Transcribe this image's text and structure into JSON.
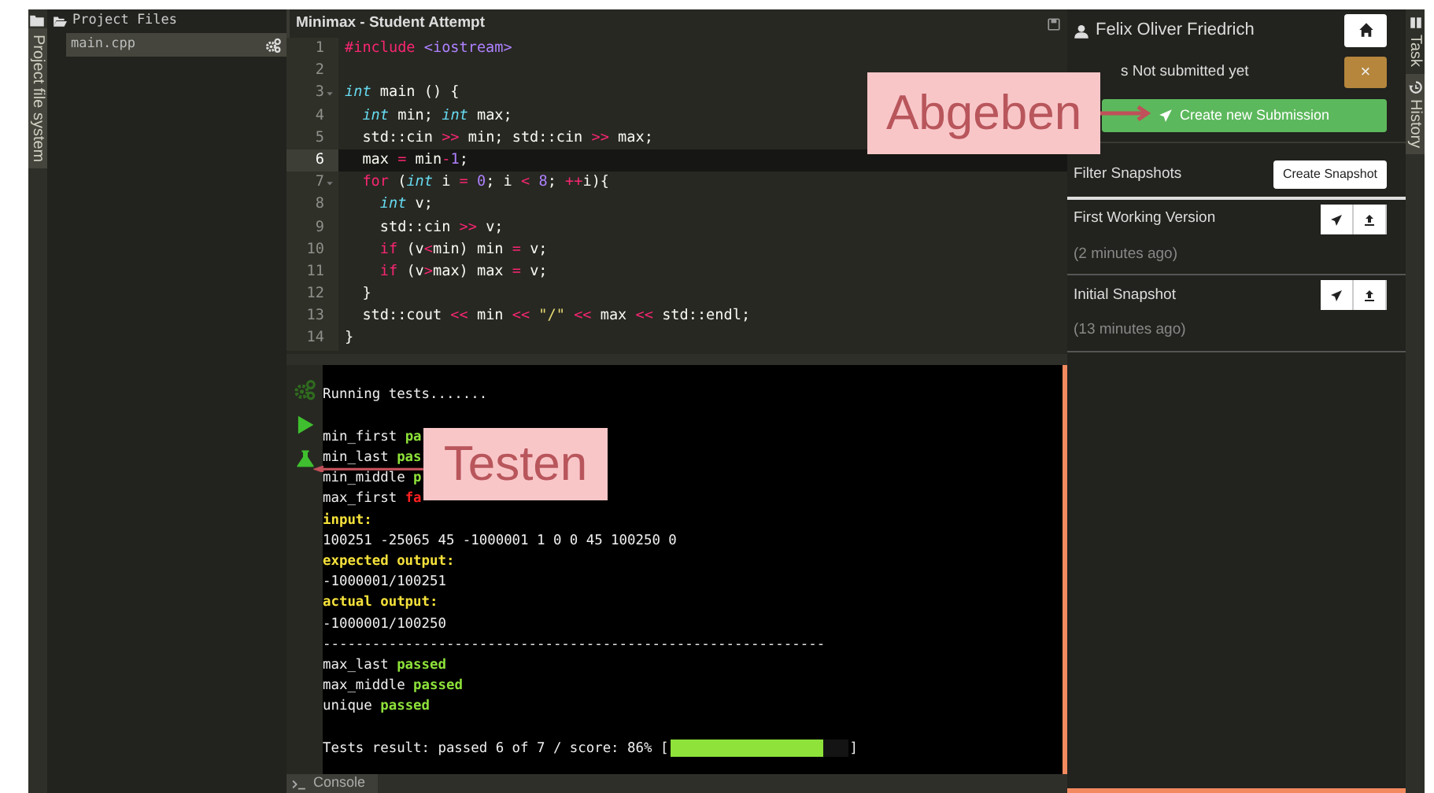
{
  "left_tabs": [
    {
      "label": "Project file system",
      "selected": true
    }
  ],
  "files": {
    "title": "Project Files",
    "items": [
      {
        "name": "main.cpp",
        "selected": true
      }
    ]
  },
  "editor": {
    "title": "Minimax - Student Attempt",
    "lines": [
      {
        "number": "1",
        "fold": false,
        "active": false,
        "tokens": [
          {
            "kind": "keyword",
            "text": "#include"
          },
          {
            "kind": "header",
            "text": " <iostream>"
          }
        ]
      },
      {
        "number": "2",
        "fold": false,
        "active": false
      },
      {
        "number": "3",
        "fold": true,
        "active": false,
        "tokens": [
          {
            "kind": "type",
            "text": "int"
          },
          {
            "kind": "plain",
            "text": " main () {"
          }
        ]
      },
      {
        "number": "4",
        "fold": false,
        "active": false,
        "tokens": [
          {
            "kind": "type",
            "text": "  int"
          },
          {
            "kind": "plain",
            "text": " min; "
          },
          {
            "kind": "type",
            "text": "int"
          },
          {
            "kind": "plain",
            "text": " max;"
          }
        ]
      },
      {
        "number": "5",
        "fold": false,
        "active": false,
        "tokens": [
          {
            "kind": "plain",
            "text": "  std::cin "
          },
          {
            "kind": "operator",
            "text": ">>"
          },
          {
            "kind": "plain",
            "text": " min; std::cin "
          },
          {
            "kind": "operator",
            "text": ">>"
          },
          {
            "kind": "plain",
            "text": " max;"
          }
        ]
      },
      {
        "number": "6",
        "fold": false,
        "active": true,
        "tokens": [
          {
            "kind": "plain",
            "text": "  max "
          },
          {
            "kind": "operator",
            "text": "="
          },
          {
            "kind": "plain",
            "text": " min"
          },
          {
            "kind": "operator",
            "text": "-"
          },
          {
            "kind": "number",
            "text": "1"
          },
          {
            "kind": "plain",
            "text": ";"
          }
        ]
      },
      {
        "number": "7",
        "fold": true,
        "active": false,
        "tokens": [
          {
            "kind": "keyword",
            "text": "  for"
          },
          {
            "kind": "plain",
            "text": " ("
          },
          {
            "kind": "type",
            "text": "int"
          },
          {
            "kind": "plain",
            "text": " i "
          },
          {
            "kind": "operator",
            "text": "="
          },
          {
            "kind": "number",
            "text": " 0"
          },
          {
            "kind": "plain",
            "text": "; i "
          },
          {
            "kind": "operator",
            "text": "<"
          },
          {
            "kind": "number",
            "text": " 8"
          },
          {
            "kind": "plain",
            "text": "; "
          },
          {
            "kind": "operator",
            "text": "++"
          },
          {
            "kind": "plain",
            "text": "i){"
          }
        ]
      },
      {
        "number": "8",
        "fold": false,
        "active": false,
        "tokens": [
          {
            "kind": "type",
            "text": "    int"
          },
          {
            "kind": "plain",
            "text": " v;"
          }
        ]
      },
      {
        "number": "9",
        "fold": false,
        "active": false,
        "tokens": [
          {
            "kind": "plain",
            "text": "    std::cin "
          },
          {
            "kind": "operator",
            "text": ">>"
          },
          {
            "kind": "plain",
            "text": " v;"
          }
        ]
      },
      {
        "number": "10",
        "fold": false,
        "active": false,
        "tokens": [
          {
            "kind": "keyword",
            "text": "    if"
          },
          {
            "kind": "plain",
            "text": " (v"
          },
          {
            "kind": "operator",
            "text": "<"
          },
          {
            "kind": "plain",
            "text": "min) min "
          },
          {
            "kind": "operator",
            "text": "="
          },
          {
            "kind": "plain",
            "text": " v;"
          }
        ]
      },
      {
        "number": "11",
        "fold": false,
        "active": false,
        "tokens": [
          {
            "kind": "keyword",
            "text": "    if"
          },
          {
            "kind": "plain",
            "text": " (v"
          },
          {
            "kind": "operator",
            "text": ">"
          },
          {
            "kind": "plain",
            "text": "max) max "
          },
          {
            "kind": "operator",
            "text": "="
          },
          {
            "kind": "plain",
            "text": " v;"
          }
        ]
      },
      {
        "number": "12",
        "fold": false,
        "active": false,
        "tokens": [
          {
            "kind": "plain",
            "text": "  }"
          }
        ]
      },
      {
        "number": "13",
        "fold": false,
        "active": false,
        "tokens": [
          {
            "kind": "plain",
            "text": "  std::cout "
          },
          {
            "kind": "operator",
            "text": "<<"
          },
          {
            "kind": "plain",
            "text": " min "
          },
          {
            "kind": "operator",
            "text": "<<"
          },
          {
            "kind": "string",
            "text": " \"/\""
          },
          {
            "kind": "operator",
            "text": " <<"
          },
          {
            "kind": "plain",
            "text": " max "
          },
          {
            "kind": "operator",
            "text": "<<"
          },
          {
            "kind": "plain",
            "text": " std::endl;"
          }
        ]
      },
      {
        "number": "14",
        "fold": false,
        "active": false,
        "tokens": [
          {
            "kind": "plain",
            "text": "}"
          }
        ]
      }
    ]
  },
  "console": {
    "lines": [
      {
        "kind": "plain",
        "text": "Running tests......."
      },
      {
        "kind": "blank"
      },
      {
        "kind": "result",
        "name": "min_first ",
        "status": "pa",
        "passed": true
      },
      {
        "kind": "result",
        "name": "min_last ",
        "status": "pas",
        "passed": true
      },
      {
        "kind": "result",
        "name": "min_middle ",
        "status": "p",
        "passed": true
      },
      {
        "kind": "result",
        "name": "max_first ",
        "status": "fa",
        "passed": false
      },
      {
        "kind": "label",
        "text": "input:"
      },
      {
        "kind": "plain",
        "text": "100251 -25065 45 -1000001 1 0 0 45 100250 0"
      },
      {
        "kind": "label",
        "text": "expected output:"
      },
      {
        "kind": "plain",
        "text": "-1000001/100251"
      },
      {
        "kind": "label",
        "text": "actual output:"
      },
      {
        "kind": "plain",
        "text": "-1000001/100250"
      },
      {
        "kind": "plain",
        "text": "-------------------------------------------------------------"
      },
      {
        "kind": "result",
        "name": "max_last ",
        "status": "passed",
        "passed": true
      },
      {
        "kind": "result",
        "name": "max_middle ",
        "status": "passed",
        "passed": true
      },
      {
        "kind": "result",
        "name": "unique ",
        "status": "passed",
        "passed": true
      },
      {
        "kind": "blank"
      },
      {
        "kind": "progress",
        "text": "Tests result: passed 6 of 7 / score: 86% [",
        "level": 0.86,
        "end": "]"
      }
    ],
    "tab": "Console"
  },
  "user": {
    "name": "Felix Oliver Friedrich"
  },
  "status": {
    "text": "s Not submitted yet",
    "close": "×"
  },
  "submit_button": "Create new Submission",
  "snapshots": {
    "filter_label": "Filter Snapshots",
    "create_button": "Create Snapshot",
    "items": [
      {
        "title": "First Working Version",
        "time": "(2 minutes ago)"
      },
      {
        "title": "Initial Snapshot",
        "time": "(13 minutes ago)"
      }
    ]
  },
  "right_tabs": [
    {
      "label": "Task",
      "selected": false
    },
    {
      "label": "History",
      "selected": true
    }
  ],
  "annotations": [
    {
      "kind": "submit",
      "text": "Abgeben"
    },
    {
      "kind": "test",
      "text": "Testen"
    }
  ]
}
